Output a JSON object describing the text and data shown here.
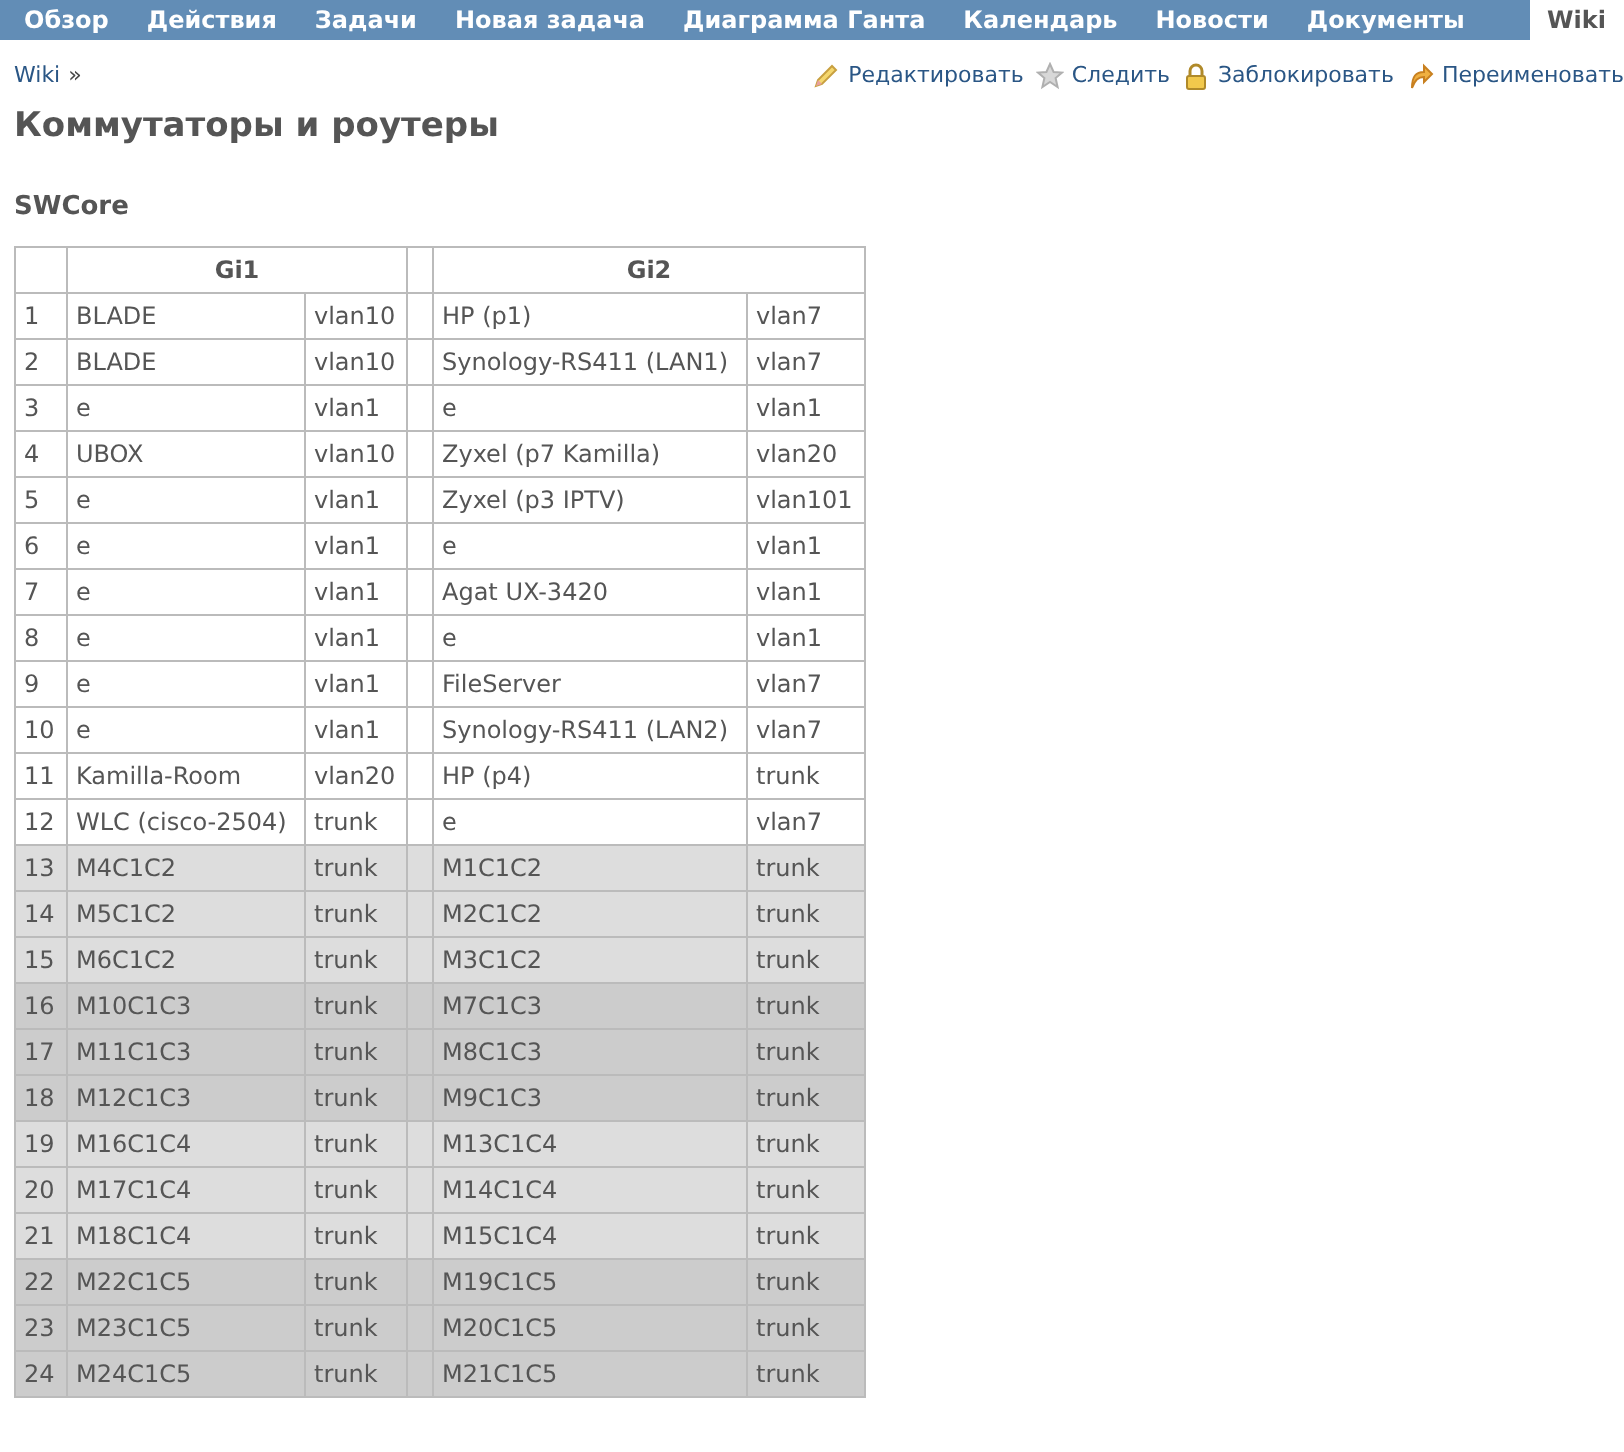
{
  "tabs": [
    {
      "label": "Обзор",
      "selected": false
    },
    {
      "label": "Действия",
      "selected": false
    },
    {
      "label": "Задачи",
      "selected": false
    },
    {
      "label": "Новая задача",
      "selected": false
    },
    {
      "label": "Диаграмма Ганта",
      "selected": false
    },
    {
      "label": "Календарь",
      "selected": false
    },
    {
      "label": "Новости",
      "selected": false
    },
    {
      "label": "Документы",
      "selected": false
    },
    {
      "label": "Wiki",
      "selected": true
    }
  ],
  "breadcrumb": {
    "link": "Wiki",
    "separator": "»"
  },
  "actions": [
    {
      "kind": "edit",
      "label": "Редактировать"
    },
    {
      "kind": "watch",
      "label": "Следить"
    },
    {
      "kind": "lock",
      "label": "Заблокировать"
    },
    {
      "kind": "rename",
      "label": "Переименовать"
    }
  ],
  "title": "Коммутаторы и роутеры",
  "section": "SWCore",
  "table": {
    "columns": [
      "Gi1",
      "Gi2"
    ],
    "rows": [
      {
        "n": "1",
        "a": "BLADE",
        "av": "vlan10",
        "b": "HP (p1)",
        "bv": "vlan7",
        "color": "#ffffff"
      },
      {
        "n": "2",
        "a": "BLADE",
        "av": "vlan10",
        "b": "Synology-RS411 (LAN1)",
        "bv": "vlan7",
        "color": "#ffffff"
      },
      {
        "n": "3",
        "a": "e",
        "av": "vlan1",
        "b": "e",
        "bv": "vlan1",
        "color": "#ffffff"
      },
      {
        "n": "4",
        "a": "UBOX",
        "av": "vlan10",
        "b": "Zyxel (p7 Kamilla)",
        "bv": "vlan20",
        "color": "#ffffff"
      },
      {
        "n": "5",
        "a": "e",
        "av": "vlan1",
        "b": "Zyxel (p3 IPTV)",
        "bv": "vlan101",
        "color": "#ffffff"
      },
      {
        "n": "6",
        "a": "e",
        "av": "vlan1",
        "b": "e",
        "bv": "vlan1",
        "color": "#ffffff"
      },
      {
        "n": "7",
        "a": "e",
        "av": "vlan1",
        "b": "Agat UX-3420",
        "bv": "vlan1",
        "color": "#ffffff"
      },
      {
        "n": "8",
        "a": "e",
        "av": "vlan1",
        "b": "e",
        "bv": "vlan1",
        "color": "#ffffff"
      },
      {
        "n": "9",
        "a": "e",
        "av": "vlan1",
        "b": "FileServer",
        "bv": "vlan7",
        "color": "#ffffff"
      },
      {
        "n": "10",
        "a": "e",
        "av": "vlan1",
        "b": "Synology-RS411 (LAN2)",
        "bv": "vlan7",
        "color": "#ffffff"
      },
      {
        "n": "11",
        "a": "Kamilla-Room",
        "av": "vlan20",
        "b": "HP (p4)",
        "bv": "trunk",
        "color": "#ffffff"
      },
      {
        "n": "12",
        "a": "WLC (cisco-2504)",
        "av": "trunk",
        "b": "e",
        "bv": "vlan7",
        "color": "#ffffff"
      },
      {
        "n": "13",
        "a": "M4C1C2",
        "av": "trunk",
        "b": "M1C1C2",
        "bv": "trunk",
        "color": "#dddddd"
      },
      {
        "n": "14",
        "a": "M5C1C2",
        "av": "trunk",
        "b": "M2C1C2",
        "bv": "trunk",
        "color": "#dddddd"
      },
      {
        "n": "15",
        "a": "M6C1C2",
        "av": "trunk",
        "b": "M3C1C2",
        "bv": "trunk",
        "color": "#dddddd"
      },
      {
        "n": "16",
        "a": "M10C1C3",
        "av": "trunk",
        "b": "M7C1C3",
        "bv": "trunk",
        "color": "#cccccc"
      },
      {
        "n": "17",
        "a": "M11C1C3",
        "av": "trunk",
        "b": "M8C1C3",
        "bv": "trunk",
        "color": "#cccccc"
      },
      {
        "n": "18",
        "a": "M12C1C3",
        "av": "trunk",
        "b": "M9C1C3",
        "bv": "trunk",
        "color": "#cccccc"
      },
      {
        "n": "19",
        "a": "M16C1C4",
        "av": "trunk",
        "b": "M13C1C4",
        "bv": "trunk",
        "color": "#dddddd"
      },
      {
        "n": "20",
        "a": "M17C1C4",
        "av": "trunk",
        "b": "M14C1C4",
        "bv": "trunk",
        "color": "#dddddd"
      },
      {
        "n": "21",
        "a": "M18C1C4",
        "av": "trunk",
        "b": "M15C1C4",
        "bv": "trunk",
        "color": "#dddddd"
      },
      {
        "n": "22",
        "a": "M22C1C5",
        "av": "trunk",
        "b": "M19C1C5",
        "bv": "trunk",
        "color": "#cccccc"
      },
      {
        "n": "23",
        "a": "M23C1C5",
        "av": "trunk",
        "b": "M20C1C5",
        "bv": "trunk",
        "color": "#cccccc"
      },
      {
        "n": "24",
        "a": "M24C1C5",
        "av": "trunk",
        "b": "M21C1C5",
        "bv": "trunk",
        "color": "#cccccc"
      }
    ]
  }
}
